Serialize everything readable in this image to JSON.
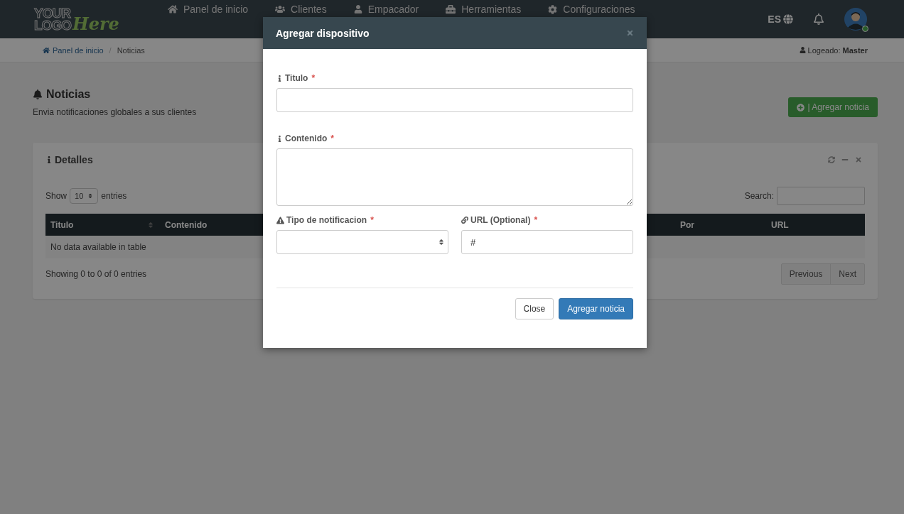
{
  "navbar": {
    "logo": {
      "line_1": "YOUR",
      "line_2": "LOGO",
      "script": "Here"
    },
    "items": [
      {
        "label": "Panel de inicio"
      },
      {
        "label": "Clientes"
      },
      {
        "label": "Empacador"
      },
      {
        "label": "Herramientas"
      },
      {
        "label": "Configuraciones"
      }
    ],
    "language": "ES",
    "user": {
      "online": true
    }
  },
  "breadcrumb": {
    "items": [
      "Panel de inicio",
      "Noticias"
    ],
    "separator": "/",
    "login_label": "Logeado:",
    "login_user": "Master"
  },
  "page": {
    "title": "Noticias",
    "subtitle": "Envia notificaciones globales a sus clientes",
    "add_button": "| Agregar noticia"
  },
  "panel": {
    "title": "Detalles",
    "show_label": "Show",
    "page_size": "10",
    "entries_label": "entries",
    "search_label": "Search:",
    "columns": [
      "Titulo",
      "Contenido",
      "Por",
      "URL"
    ],
    "empty": "No data available in table",
    "info": "Showing 0 to 0 of 0 entries",
    "pager": [
      "Previous",
      "Next"
    ]
  },
  "modal": {
    "title": "Agregar dispositivo",
    "fields": [
      {
        "label": "Titulo",
        "kind": "text",
        "required_mark": "*"
      },
      {
        "label": "Contenido",
        "kind": "textarea",
        "required_mark": "*"
      },
      {
        "label": "Tipo de notificacion",
        "kind": "select",
        "required_mark": "*"
      },
      {
        "label": "URL (Optional)",
        "kind": "text",
        "required_mark": "*",
        "value": "#"
      }
    ],
    "buttons": [
      {
        "label": "Close",
        "kind": "default"
      },
      {
        "label": "Agregar noticia",
        "kind": "primary"
      }
    ]
  }
}
